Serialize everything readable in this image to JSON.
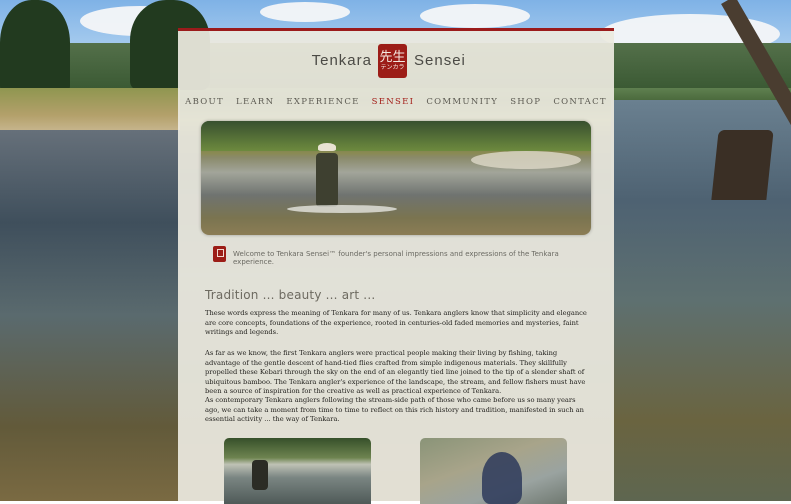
{
  "brand": {
    "word_left": "Tenkara",
    "word_right": "Sensei",
    "seal_main": "先生",
    "seal_sub": "テンカラ"
  },
  "nav": {
    "items": [
      {
        "label": "ABOUT",
        "active": false
      },
      {
        "label": "LEARN",
        "active": false
      },
      {
        "label": "EXPERIENCE",
        "active": false
      },
      {
        "label": "SENSEI",
        "active": true
      },
      {
        "label": "COMMUNITY",
        "active": false
      },
      {
        "label": "SHOP",
        "active": false
      },
      {
        "label": "CONTACT",
        "active": false
      }
    ]
  },
  "welcome": "Welcome to Tenkara Sensei™ founder's personal impressions and expressions of the Tenkara experience.",
  "article": {
    "heading": "Tradition ... beauty ... art ...",
    "p1": "These words express the meaning of Tenkara for many of us. Tenkara anglers know that simplicity and elegance are core concepts, foundations of the experience, rooted in centuries-old faded memories and mysteries, faint writings and legends.",
    "p2": "As far as we know, the first Tenkara anglers were practical people making their living by fishing, taking advantage of the gentle descent of hand-tied flies crafted from simple indigenous materials. They skillfully propelled these Kebari through the sky on the end of an elegantly tied line joined to the tip of a slender shaft of ubiquitous bamboo. The Tenkara angler's experience of the landscape, the stream, and fellow fishers must have been a source of inspiration for the creative as well as practical experience of Tenkara.",
    "p3": "As contemporary Tenkara anglers following the stream-side path of those who came before us so many years ago, we can take a moment from time to time to reflect on this rich history and tradition, manifested in such an essential activity ... the way of Tenkara."
  },
  "colors": {
    "accent": "#9b1b1b",
    "panel": "#ece9df",
    "text": "#1e1d1a",
    "muted": "#6d6a60"
  }
}
